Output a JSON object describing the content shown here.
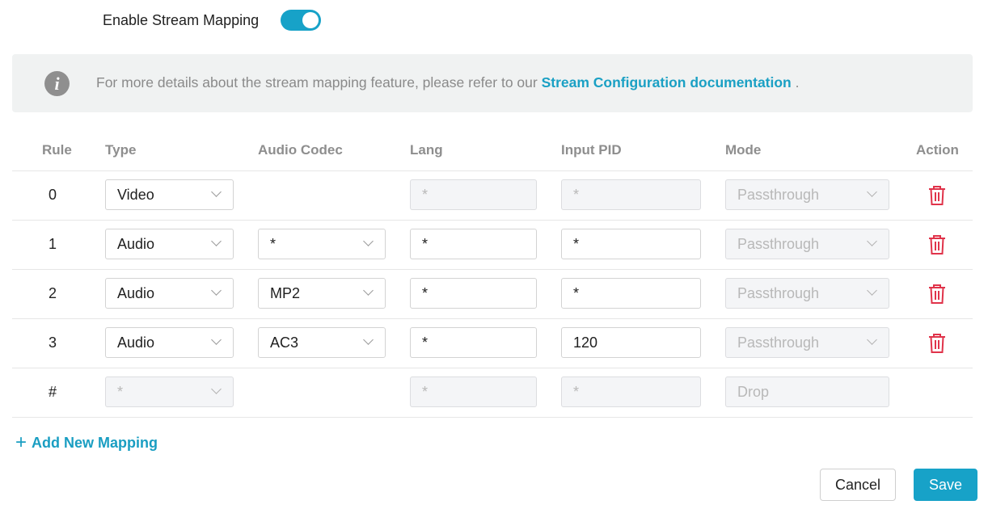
{
  "stream_mapping": {
    "toggle_label": "Enable Stream Mapping",
    "enabled": true,
    "accent_color": "#17a2c8"
  },
  "info": {
    "icon": "info-icon",
    "text_prefix": "For more details about the stream mapping feature, please refer to our ",
    "link_text": "Stream Configuration documentation",
    "text_suffix": " ."
  },
  "table": {
    "headers": {
      "rule": "Rule",
      "type": "Type",
      "audio_codec": "Audio Codec",
      "lang": "Lang",
      "input_pid": "Input PID",
      "mode": "Mode",
      "action": "Action"
    },
    "rows": [
      {
        "rule": "0",
        "type": "Video",
        "audio_codec": "",
        "lang": "*",
        "input_pid": "*",
        "mode": "Passthrough"
      },
      {
        "rule": "1",
        "type": "Audio",
        "audio_codec": "*",
        "lang": "*",
        "input_pid": "*",
        "mode": "Passthrough"
      },
      {
        "rule": "2",
        "type": "Audio",
        "audio_codec": "MP2",
        "lang": "*",
        "input_pid": "*",
        "mode": "Passthrough"
      },
      {
        "rule": "3",
        "type": "Audio",
        "audio_codec": "AC3",
        "lang": "*",
        "input_pid": "120",
        "mode": "Passthrough"
      }
    ],
    "default_row": {
      "rule": "#",
      "type": "*",
      "lang": "*",
      "input_pid": "*",
      "mode": "Drop"
    },
    "delete_icon": "trash-icon",
    "delete_color": "#e0334a"
  },
  "add_mapping_label": "Add New Mapping",
  "buttons": {
    "cancel": "Cancel",
    "save": "Save"
  }
}
